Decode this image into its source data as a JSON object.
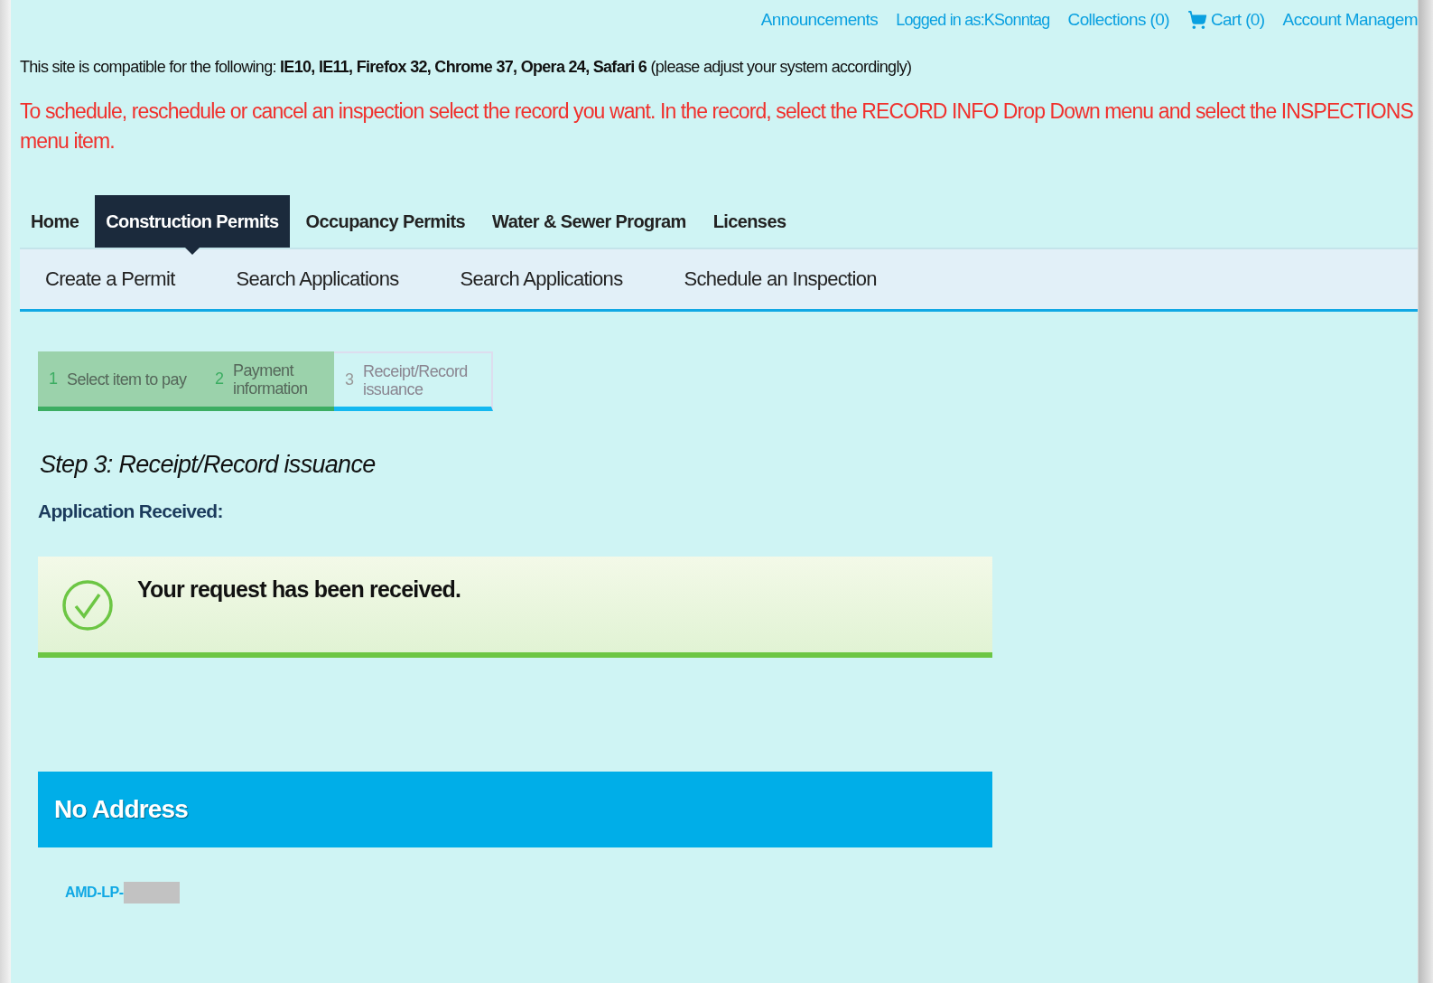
{
  "top_links": [
    {
      "label": "Announcements",
      "kind": "link"
    },
    {
      "label": "Logged in as:KSonntag",
      "kind": "text"
    },
    {
      "label": "Collections (0)",
      "kind": "link"
    },
    {
      "label": "Cart (0)",
      "kind": "cart"
    },
    {
      "label": "Account Managem",
      "kind": "link"
    }
  ],
  "compatibility": "This site is compatible for the following: **IE10, IE11, Firefox 32, Chrome 37, Opera 24, Safari 6** (please adjust your system accordingly)",
  "notice": "To schedule, reschedule or cancel an inspection select the record you want. In the record, select the RECORD INFO Drop Down menu and select the INSPECTIONS menu item.",
  "tabs": [
    {
      "label": "Home",
      "selected": false
    },
    {
      "label": "Construction Permits",
      "selected": true
    },
    {
      "label": "Occupancy Permits",
      "selected": false
    },
    {
      "label": "Water & Sewer Program",
      "selected": false
    },
    {
      "label": "Licenses",
      "selected": false
    }
  ],
  "subnav": [
    "Create a Permit",
    "Search Applications",
    "Search Applications",
    "Schedule an Inspection"
  ],
  "steps": [
    {
      "number": "1",
      "label": "Select item to pay",
      "done": true
    },
    {
      "number": "2",
      "label": "Payment information",
      "done": true
    },
    {
      "number": "3",
      "label": "Receipt/Record issuance",
      "done": false
    }
  ],
  "step_title": "Step 3: Receipt/Record issuance",
  "section_label": "Application Received:",
  "message": "Your request has been received.",
  "address_header": "No Address",
  "record_link": "AMD-LP-"
}
